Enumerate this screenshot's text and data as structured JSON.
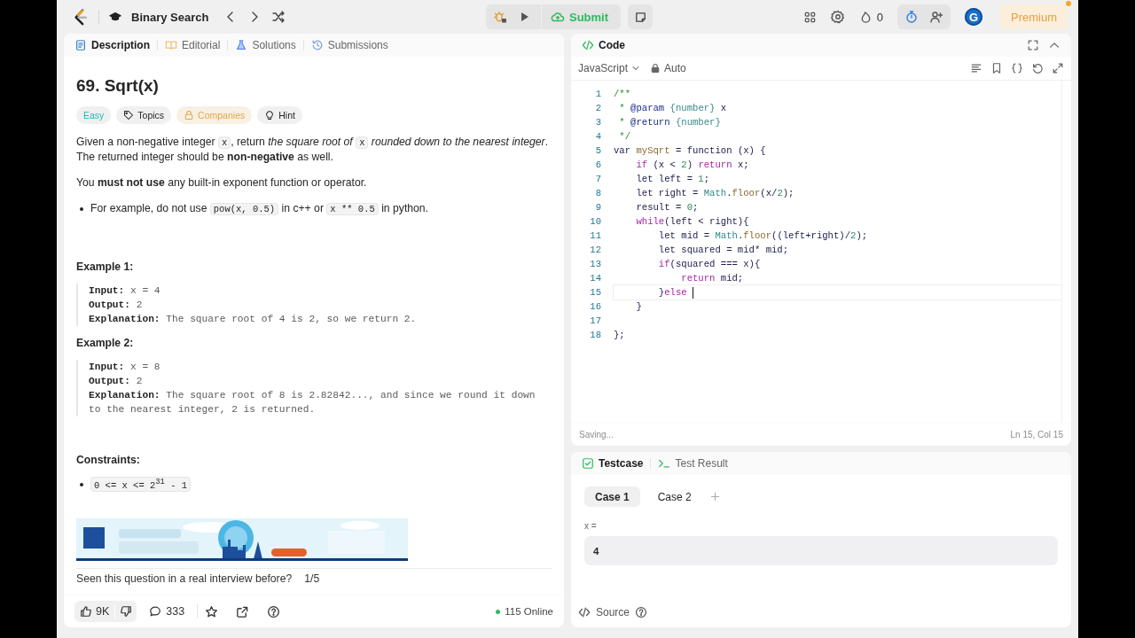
{
  "topbar": {
    "problem_list": "Binary Search",
    "submit": "Submit",
    "streak": "0",
    "timer_active": true,
    "avatar": "G",
    "premium": "Premium"
  },
  "description": {
    "tabs": [
      {
        "label": "Description",
        "kind": "description",
        "selected": true
      },
      {
        "label": "Editorial",
        "kind": "editorial",
        "selected": false
      },
      {
        "label": "Solutions",
        "kind": "solutions",
        "selected": false
      },
      {
        "label": "Submissions",
        "kind": "submissions",
        "selected": false
      }
    ],
    "title": "69. Sqrt(x)",
    "tags": [
      {
        "label": "Easy",
        "kind": "difficulty"
      },
      {
        "label": "Topics",
        "kind": "topics"
      },
      {
        "label": "Companies",
        "kind": "companies"
      },
      {
        "label": "Hint",
        "kind": "hint"
      }
    ],
    "blocks": [
      {
        "kind": "paragraph",
        "segments": [
          {
            "kind": "text",
            "text": "Given a non-negative integer "
          },
          {
            "kind": "code",
            "text": "x"
          },
          {
            "kind": "text",
            "text": ", return *the square root of* "
          },
          {
            "kind": "code",
            "text": "x"
          },
          {
            "kind": "text",
            "text": " *rounded down to the nearest integer*. The returned integer should be **non-negative** as well."
          }
        ]
      },
      {
        "kind": "paragraph",
        "segments": [
          {
            "kind": "text",
            "text": "You **must not use** any built-in exponent function or operator."
          }
        ]
      },
      {
        "kind": "bullet",
        "segments": [
          {
            "kind": "text",
            "text": "For example, do not use "
          },
          {
            "kind": "code",
            "text": "pow(x, 0.5)"
          },
          {
            "kind": "text",
            "text": " in c++ or "
          },
          {
            "kind": "code",
            "text": "x ** 0.5"
          },
          {
            "kind": "text",
            "text": " in python."
          }
        ]
      }
    ],
    "examples": [
      {
        "title": "Example 1:",
        "lines": [
          {
            "label": "Input:",
            "value": "x = 4"
          },
          {
            "label": "Output:",
            "value": "2"
          },
          {
            "label": "Explanation:",
            "value": "The square root of 4 is 2, so we return 2."
          }
        ]
      },
      {
        "title": "Example 2:",
        "lines": [
          {
            "label": "Input:",
            "value": "x = 8"
          },
          {
            "label": "Output:",
            "value": "2"
          },
          {
            "label": "Explanation:",
            "value": "The square root of 8 is 2.82842..., and since we round it down to the nearest integer, 2 is returned."
          }
        ]
      }
    ],
    "constraints_title": "Constraints:",
    "constraints": [
      "0 <= x <= 2$^{31}$ - 1"
    ],
    "ad": {
      "kind": "picture"
    },
    "interview_prompt": "Seen this question in a real interview before?",
    "interview_count": "1/5",
    "footer": {
      "likes": "9K",
      "comments": "333",
      "online": "115 Online"
    }
  },
  "code": {
    "title": "Code",
    "language": "JavaScript",
    "mode": "Auto",
    "lines": [
      {
        "n": "1",
        "current": false,
        "tokens": [
          {
            "kind": "com",
            "text": "/**"
          }
        ]
      },
      {
        "n": "2",
        "current": false,
        "tokens": [
          {
            "kind": "com",
            "text": " * "
          },
          {
            "kind": "tag",
            "text": "@param "
          },
          {
            "kind": "type",
            "text": "{number}"
          },
          {
            "kind": "txt",
            "text": " x"
          }
        ]
      },
      {
        "n": "3",
        "current": false,
        "tokens": [
          {
            "kind": "com",
            "text": " * "
          },
          {
            "kind": "tag",
            "text": "@return "
          },
          {
            "kind": "type",
            "text": "{number}"
          }
        ]
      },
      {
        "n": "4",
        "current": false,
        "tokens": [
          {
            "kind": "com",
            "text": " */"
          }
        ]
      },
      {
        "n": "5",
        "current": false,
        "tokens": [
          {
            "kind": "txt",
            "text": "var "
          },
          {
            "kind": "fn",
            "text": "mySqrt"
          },
          {
            "kind": "txt",
            "text": " = function (x) {"
          }
        ]
      },
      {
        "n": "6",
        "current": false,
        "tokens": [
          {
            "kind": "kw",
            "text": "    if"
          },
          {
            "kind": "txt",
            "text": " (x < "
          },
          {
            "kind": "num",
            "text": "2"
          },
          {
            "kind": "txt",
            "text": ") "
          },
          {
            "kind": "kw",
            "text": "return"
          },
          {
            "kind": "txt",
            "text": " x;"
          }
        ]
      },
      {
        "n": "7",
        "current": false,
        "tokens": [
          {
            "kind": "txt",
            "text": "    let left = "
          },
          {
            "kind": "num",
            "text": "1"
          },
          {
            "kind": "txt",
            "text": ";"
          }
        ]
      },
      {
        "n": "8",
        "current": false,
        "tokens": [
          {
            "kind": "txt",
            "text": "    let right = "
          },
          {
            "kind": "cls",
            "text": "Math"
          },
          {
            "kind": "txt",
            "text": "."
          },
          {
            "kind": "fn",
            "text": "floor"
          },
          {
            "kind": "txt",
            "text": "(x/"
          },
          {
            "kind": "num",
            "text": "2"
          },
          {
            "kind": "txt",
            "text": ");"
          }
        ]
      },
      {
        "n": "9",
        "current": false,
        "tokens": [
          {
            "kind": "txt",
            "text": "    result = "
          },
          {
            "kind": "num",
            "text": "0"
          },
          {
            "kind": "txt",
            "text": ";"
          }
        ]
      },
      {
        "n": "10",
        "current": false,
        "tokens": [
          {
            "kind": "kw",
            "text": "    while"
          },
          {
            "kind": "txt",
            "text": "(left < right){"
          }
        ]
      },
      {
        "n": "11",
        "current": false,
        "tokens": [
          {
            "kind": "txt",
            "text": "        let mid = "
          },
          {
            "kind": "cls",
            "text": "Math"
          },
          {
            "kind": "txt",
            "text": "."
          },
          {
            "kind": "fn",
            "text": "floor"
          },
          {
            "kind": "txt",
            "text": "((left+right)/"
          },
          {
            "kind": "num",
            "text": "2"
          },
          {
            "kind": "txt",
            "text": ");"
          }
        ]
      },
      {
        "n": "12",
        "current": false,
        "tokens": [
          {
            "kind": "txt",
            "text": "        let squared = mid* mid;"
          }
        ]
      },
      {
        "n": "13",
        "current": false,
        "tokens": [
          {
            "kind": "kw",
            "text": "        if"
          },
          {
            "kind": "txt",
            "text": "(squared === x){"
          }
        ]
      },
      {
        "n": "14",
        "current": false,
        "tokens": [
          {
            "kind": "kw",
            "text": "            return"
          },
          {
            "kind": "txt",
            "text": " mid;"
          }
        ]
      },
      {
        "n": "15",
        "current": true,
        "tokens": [
          {
            "kind": "txt",
            "text": "        }"
          },
          {
            "kind": "kw",
            "text": "else"
          }
        ]
      },
      {
        "n": "16",
        "current": false,
        "tokens": [
          {
            "kind": "txt",
            "text": "    }"
          }
        ]
      },
      {
        "n": "17",
        "current": false
      },
      {
        "n": "18",
        "current": false,
        "tokens": [
          {
            "kind": "txt",
            "text": "};"
          }
        ]
      }
    ],
    "status": "Saving...",
    "position": "Ln 15, Col 15"
  },
  "tests": {
    "tabs": [
      {
        "label": "Testcase",
        "kind": "testcase",
        "selected": true
      },
      {
        "label": "Test Result",
        "kind": "result",
        "selected": false
      }
    ],
    "cases": [
      {
        "label": "Case 1",
        "selected": true
      },
      {
        "label": "Case 2",
        "selected": false
      }
    ],
    "params": [
      {
        "name": "x =",
        "value": "4"
      }
    ],
    "source": "Source"
  }
}
